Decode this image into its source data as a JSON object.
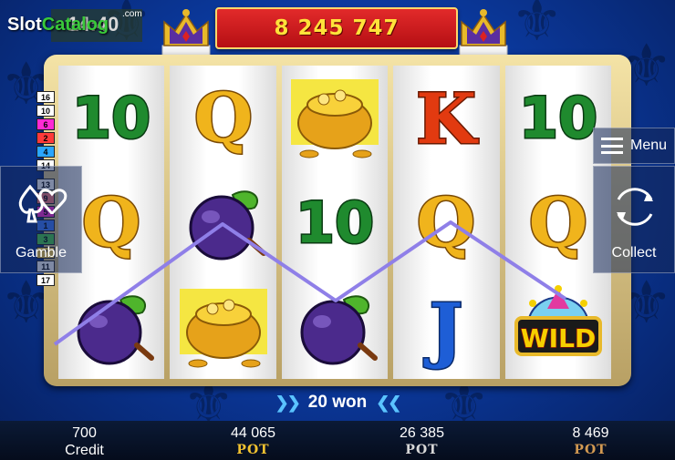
{
  "logo": {
    "brand_part1": "Slot",
    "brand_part2": "Catalog",
    "suffix": ".com",
    "clock": "14:40"
  },
  "jackpot": {
    "value": "8 245 747"
  },
  "menu": {
    "label": "Menu",
    "icon": "hamburger-icon"
  },
  "gamble": {
    "label": "Gamble",
    "icon": "card-suits-icon"
  },
  "collect": {
    "label": "Collect",
    "icon": "circular-arrows-icon"
  },
  "line_numbers": {
    "upper": [
      {
        "n": "16",
        "color": "#ffffff"
      },
      {
        "n": "10",
        "color": "#ffffff"
      },
      {
        "n": "6",
        "color": "#ff2ad4"
      },
      {
        "n": "2",
        "color": "#ff3a3a"
      },
      {
        "n": "4",
        "color": "#2aa6ff"
      },
      {
        "n": "14",
        "color": "#ffffff"
      }
    ],
    "lower": [
      {
        "n": "13",
        "color": "#ffffff"
      },
      {
        "n": "9",
        "color": "#ff7a7a"
      },
      {
        "n": "5",
        "color": "#ff2ad4"
      },
      {
        "n": "1",
        "color": "#3a7aff"
      },
      {
        "n": "3",
        "color": "#4ad04a"
      },
      {
        "n": "7",
        "color": "#ffd040"
      },
      {
        "n": "11",
        "color": "#ffffff"
      },
      {
        "n": "17",
        "color": "#ffffff"
      }
    ]
  },
  "reels": [
    [
      "ten",
      "queen",
      "plum"
    ],
    [
      "queen",
      "plum",
      "gold-pot"
    ],
    [
      "gold-pot",
      "ten",
      "plum"
    ],
    [
      "king",
      "queen",
      "jack"
    ],
    [
      "ten",
      "queen",
      "wild"
    ]
  ],
  "symbol_text": {
    "ten": "10",
    "queen": "Q",
    "king": "K",
    "jack": "J",
    "wild": "WILD"
  },
  "win": {
    "text": "20 won",
    "arrows_left": "❯❯",
    "arrows_right": "❮❮"
  },
  "bottom": {
    "credit": {
      "value": "700",
      "label": "Credit"
    },
    "pots": [
      {
        "value": "44 065",
        "label": "POT",
        "tier": "gold"
      },
      {
        "value": "26 385",
        "label": "POT",
        "tier": "silver"
      },
      {
        "value": "8 469",
        "label": "POT",
        "tier": "bronze"
      }
    ]
  },
  "colors": {
    "payline": "#8f7fe8",
    "ten_green": "#1f8a2e",
    "queen_gold": "#f0b41c",
    "king_red": "#e23a10",
    "jack_blue": "#1e5ed6",
    "plum": "#4b2a8c"
  }
}
